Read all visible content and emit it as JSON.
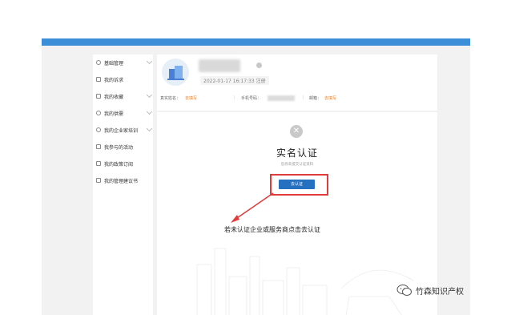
{
  "sidebar": {
    "items": [
      {
        "label": "基础管理",
        "icon": "gear-icon",
        "has_chevron": true
      },
      {
        "label": "我的诉求",
        "icon": "document-icon",
        "has_chevron": false
      },
      {
        "label": "我的收藏",
        "icon": "star-icon",
        "has_chevron": true
      },
      {
        "label": "我的供需",
        "icon": "hexagon-icon",
        "has_chevron": true
      },
      {
        "label": "我的企业家培训",
        "icon": "people-icon",
        "has_chevron": true
      },
      {
        "label": "我参与的活动",
        "icon": "calendar-icon",
        "has_chevron": false
      },
      {
        "label": "我的政策订阅",
        "icon": "list-icon",
        "has_chevron": false
      },
      {
        "label": "我的管理建议书",
        "icon": "edit-icon",
        "has_chevron": false
      }
    ]
  },
  "profile": {
    "registered": "2022-01-17 16:17:33 注册",
    "real_name_label": "真实姓名：",
    "real_name_value": "去填写",
    "phone_label": "手机号码：",
    "email_label": "邮箱：",
    "email_value": "去填写"
  },
  "auth": {
    "title": "实名认证",
    "subtitle": "您尚未提交认证资料",
    "button": "去认证",
    "annotation": "若未认证企业或服务商点击去认证"
  },
  "watermark": {
    "text": "竹森知识产权"
  },
  "colors": {
    "topbar": "#3c8ed8",
    "button": "#2670c2",
    "highlight": "#e23b3b",
    "link": "#e8832a"
  }
}
